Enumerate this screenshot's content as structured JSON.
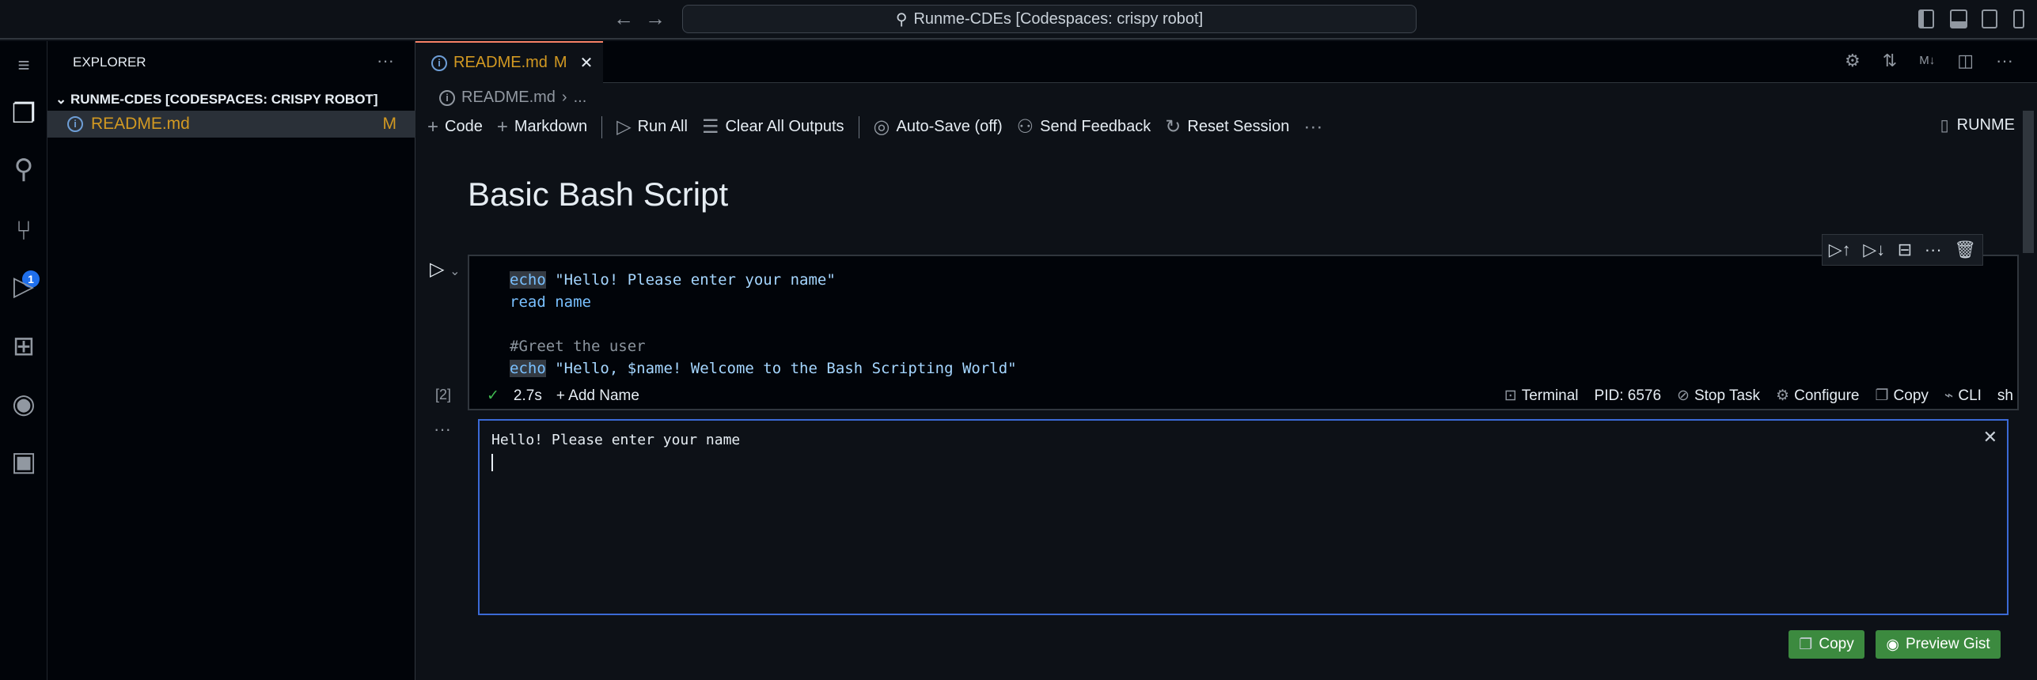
{
  "titlebar": {
    "search": "Runme-CDEs [Codespaces: crispy robot]",
    "back_icon": "arrow-left",
    "forward_icon": "arrow-right"
  },
  "activity": {
    "source_control_badge": "1",
    "items": [
      "menu",
      "explorer",
      "search",
      "source-control",
      "run-debug",
      "extensions",
      "github",
      "runme"
    ]
  },
  "sidebar": {
    "title": "EXPLORER",
    "section": "RUNME-CDES [CODESPACES: CRISPY ROBOT]",
    "files": [
      {
        "name": "README.md",
        "status": "M"
      }
    ]
  },
  "tabs": [
    {
      "label": "README.md",
      "status": "M"
    }
  ],
  "breadcrumb": {
    "file": "README.md",
    "more": "..."
  },
  "toolbar": {
    "code": "Code",
    "markdown": "Markdown",
    "run_all": "Run All",
    "clear": "Clear All Outputs",
    "autosave": "Auto-Save (off)",
    "feedback": "Send Feedback",
    "reset": "Reset Session",
    "more": "···",
    "runme": "RUNME"
  },
  "heading": "Basic Bash Script",
  "cell": {
    "lines": [
      {
        "kw": "echo",
        "rest": " \"Hello! Please enter your name\""
      },
      {
        "kw": "",
        "rest": "read name"
      },
      {
        "kw": "",
        "rest": ""
      },
      {
        "comment": "#Greet the user"
      },
      {
        "kw": "echo",
        "rest": " \"Hello, $name! Welcome to the Bash Scripting World\""
      }
    ],
    "exec_count": "[2]",
    "duration": "2.7s",
    "add_name": "Add Name",
    "terminal": "Terminal",
    "pid": "PID: 6576",
    "stop": "Stop Task",
    "configure": "Configure",
    "copy": "Copy",
    "cli": "CLI",
    "shell": "sh"
  },
  "output": {
    "text": "Hello! Please enter your name",
    "copy": "Copy",
    "gist": "Preview Gist"
  },
  "colors": {
    "accent": "#f78166",
    "focus": "#3b6ad6",
    "button": "#3c8a3f",
    "modified": "#d29922"
  }
}
